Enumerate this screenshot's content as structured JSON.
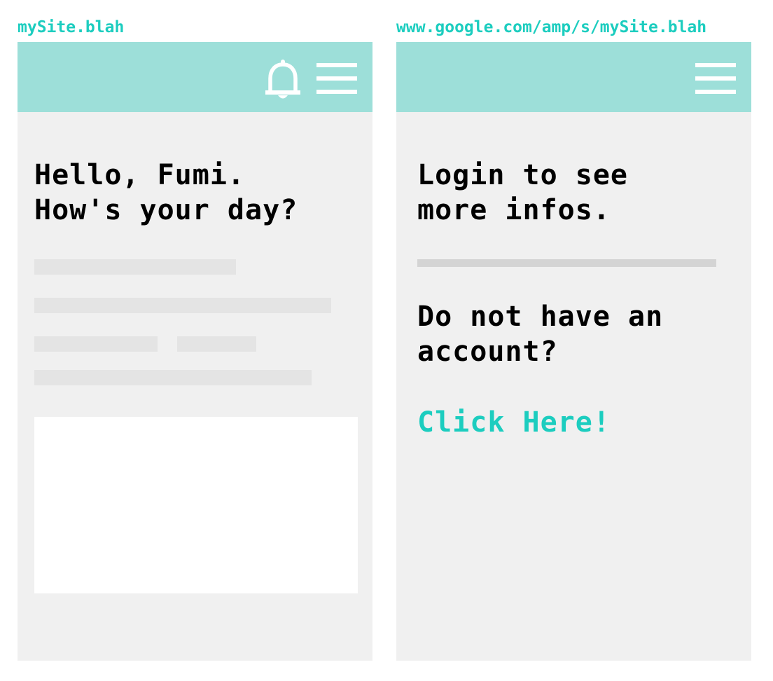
{
  "left_screen": {
    "url": "mySite.blah",
    "greeting": "Hello, Fumi.\nHow's your day?",
    "icons": [
      "bell-icon",
      "menu-icon"
    ]
  },
  "right_screen": {
    "url": "www.google.com/amp/s/mySite.blah",
    "login_prompt": "Login to see\nmore infos.",
    "account_prompt": "Do not have an\naccount?",
    "link_label": "Click Here!",
    "icons": [
      "menu-icon"
    ]
  },
  "colors": {
    "accent": "#1ccdbf",
    "header": "#9ddfd9",
    "screen_bg": "#f0f0f0",
    "placeholder": "#e4e4e4"
  }
}
